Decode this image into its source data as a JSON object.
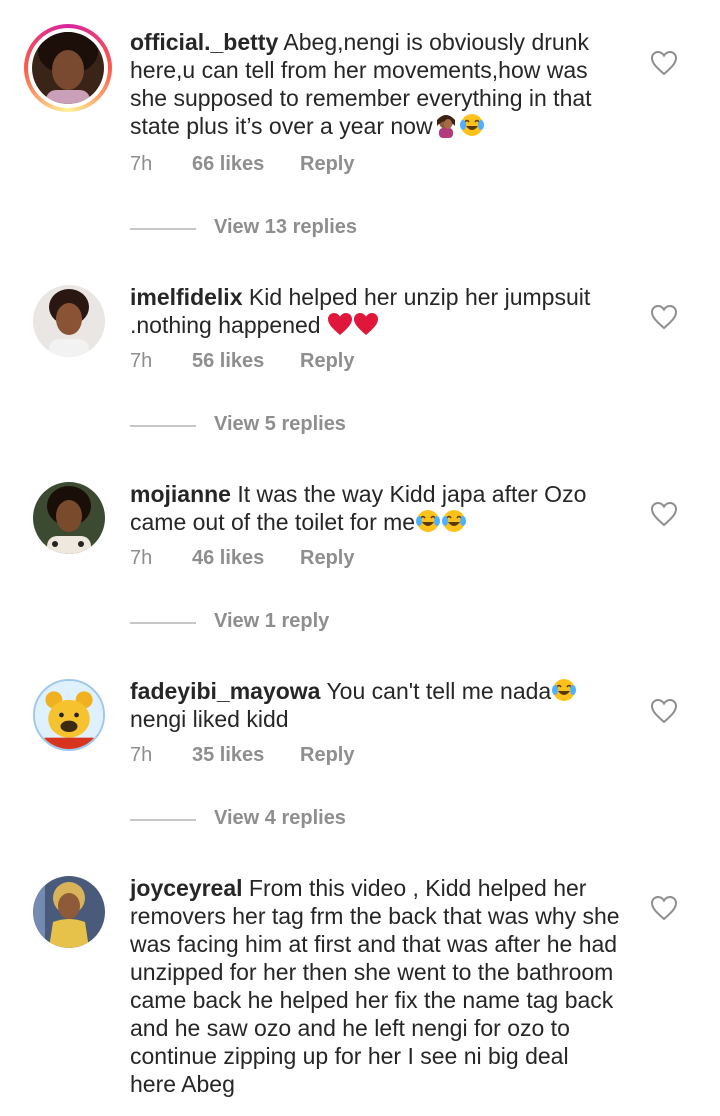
{
  "comments": [
    {
      "username": "official._betty",
      "text": "Abeg,nengi is obviously drunk here,u can tell from her movements,how was she supposed to remember everything in that state plus it’s over a year now",
      "emojis": [
        "woman-facepalming-icon",
        "face-with-tears-of-joy-icon"
      ],
      "time": "7h",
      "likes": "66 likes",
      "reply": "Reply",
      "view_replies": "View 13 replies",
      "avatar_ring": true
    },
    {
      "username": "imelfidelix",
      "text": "Kid helped her unzip her jumpsuit .nothing happened",
      "emojis": [
        "red-heart-icon",
        "red-heart-icon"
      ],
      "time": "7h",
      "likes": "56 likes",
      "reply": "Reply",
      "view_replies": "View 5 replies",
      "avatar_ring": false
    },
    {
      "username": "mojianne",
      "text": "It was the way Kidd japa after Ozo came out of the toilet for me",
      "emojis": [
        "face-with-tears-of-joy-icon",
        "face-with-tears-of-joy-icon"
      ],
      "time": "7h",
      "likes": "46 likes",
      "reply": "Reply",
      "view_replies": "View 1 reply",
      "avatar_ring": false
    },
    {
      "username": "fadeyibi_mayowa",
      "text": "You can't tell me nada",
      "text_after": "nengi liked kidd",
      "emojis": [
        "face-with-tears-of-joy-icon"
      ],
      "time": "7h",
      "likes": "35 likes",
      "reply": "Reply",
      "view_replies": "View 4 replies",
      "avatar_ring": false
    },
    {
      "username": "joyceyreal",
      "text": "From this video , Kidd helped her removers her tag frm the back that was why she was facing him at first and that was after he had unzipped for her then she went to the bathroom came back he helped her fix the name tag back and he saw ozo and he left nengi for ozo to continue zipping up for her I see ni big deal here Abeg",
      "emojis": [],
      "avatar_ring": false
    }
  ],
  "colors": {
    "text": "#262626",
    "secondary": "#8e8e8e",
    "heart_outline": "#8e8e8e",
    "divider": "#c7c7c7"
  }
}
